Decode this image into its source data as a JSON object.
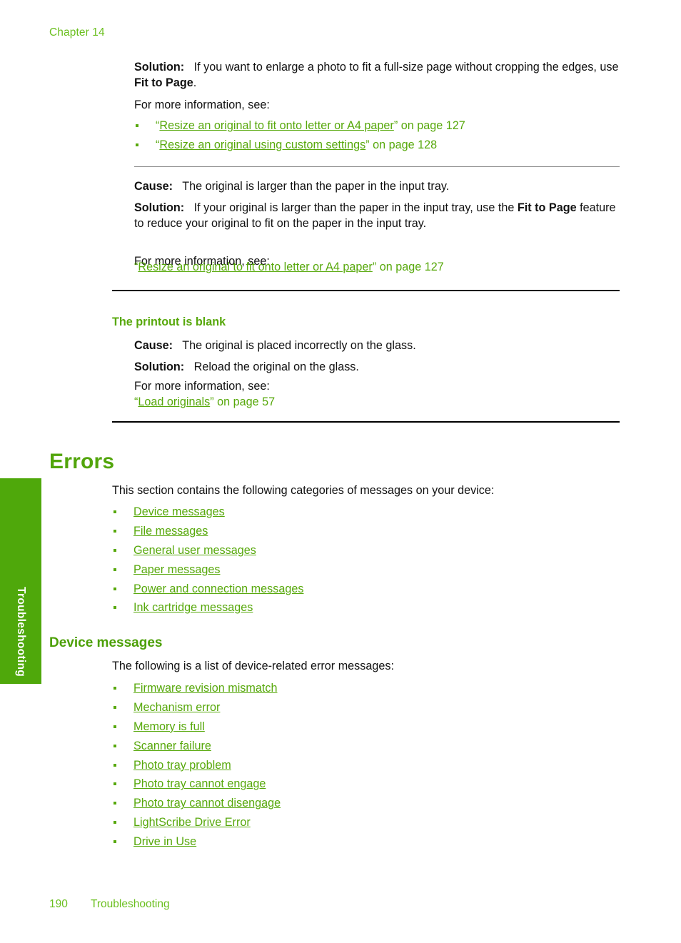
{
  "header": {
    "chapter": "Chapter 14"
  },
  "section_one": {
    "solution_label": "Solution:",
    "solution_text_a": "If you want to enlarge a photo to fit a full-size page without cropping the edges, use ",
    "solution_bold": "Fit to Page",
    "solution_text_b": ".",
    "more_info": "For more information, see:",
    "links": [
      {
        "open_quote": "“",
        "text": "Resize an original to fit onto letter or A4 paper",
        "close_quote": "”",
        "suffix": " on page 127"
      },
      {
        "open_quote": "“",
        "text": "Resize an original using custom settings",
        "close_quote": "”",
        "suffix": " on page 128"
      }
    ]
  },
  "section_two": {
    "cause_label": "Cause:",
    "cause_text": "The original is larger than the paper in the input tray.",
    "solution_label": "Solution:",
    "solution_text_a": "If your original is larger than the paper in the input tray, use the ",
    "solution_bold": "Fit to Page",
    "solution_text_b": " feature to reduce your original to fit on the paper in the input tray.",
    "more_info": "For more information, see:",
    "link": {
      "open_quote": "“",
      "text": "Resize an original to fit onto letter or A4 paper",
      "close_quote": "”",
      "suffix": " on page 127"
    }
  },
  "printout_blank": {
    "heading": "The printout is blank",
    "cause_label": "Cause:",
    "cause_text": "The original is placed incorrectly on the glass.",
    "solution_label": "Solution:",
    "solution_text": "Reload the original on the glass.",
    "more_info": "For more information, see:",
    "link": {
      "open_quote": "“",
      "text": "Load originals",
      "close_quote": "”",
      "suffix": " on page 57"
    }
  },
  "errors": {
    "heading": "Errors",
    "intro": "This section contains the following categories of messages on your device:",
    "links": [
      "Device messages",
      "File messages",
      "General user messages",
      "Paper messages",
      "Power and connection messages",
      "Ink cartridge messages"
    ]
  },
  "device_messages": {
    "heading": "Device messages",
    "intro": "The following is a list of device-related error messages:",
    "links": [
      "Firmware revision mismatch",
      "Mechanism error",
      "Memory is full",
      "Scanner failure",
      "Photo tray problem",
      "Photo tray cannot engage",
      "Photo tray cannot disengage",
      "LightScribe Drive Error",
      "Drive in Use"
    ]
  },
  "side_tab": {
    "label": "Troubleshooting"
  },
  "footer": {
    "page_number": "190",
    "section": "Troubleshooting"
  },
  "colors": {
    "accent_green": "#57a80b",
    "heading_green": "#52a50b",
    "running_head_green": "#6abf1e",
    "tab_green": "#4fa80b"
  }
}
